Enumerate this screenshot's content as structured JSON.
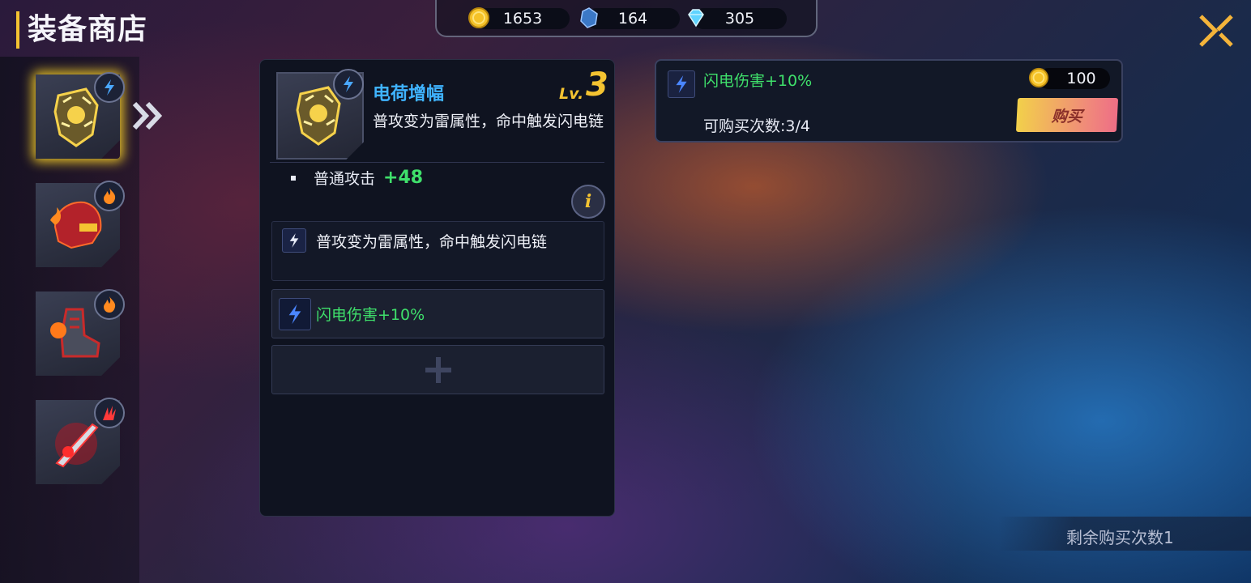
{
  "header": {
    "title": "装备商店"
  },
  "currencies": [
    {
      "icon": "gold-coin-icon",
      "value": "1653"
    },
    {
      "icon": "blue-crystal-icon",
      "value": "164"
    },
    {
      "icon": "diamond-icon",
      "value": "305"
    }
  ],
  "equipment_slots": [
    {
      "icon": "lightning-gauntlet-icon",
      "element_badge": "lightning-icon",
      "selected": true
    },
    {
      "icon": "fire-helmet-icon",
      "element_badge": "fire-icon",
      "selected": false
    },
    {
      "icon": "fire-boots-icon",
      "element_badge": "fire-icon",
      "selected": false
    },
    {
      "icon": "blood-sword-icon",
      "element_badge": "claw-icon",
      "selected": false
    }
  ],
  "detail": {
    "name": "电荷增幅",
    "level_prefix": "Lv.",
    "level": "3",
    "description": "普攻变为雷属性，命中触发闪电链",
    "stat_label": "普通攻击",
    "stat_value": "+48",
    "info_label": "i",
    "passive_text": "普攻变为雷属性，命中触发闪电链",
    "modifier_text": "闪电伤害+10%"
  },
  "offer": {
    "name": "闪电伤害+10%",
    "price": "100",
    "buy_label": "购买",
    "purchase_limit": "可购买次数:3/4"
  },
  "footer": {
    "remaining": "剩余购买次数1"
  },
  "colors": {
    "accent_gold": "#f4c331",
    "title_blue": "#3fb3ff",
    "bonus_green": "#3fe06b"
  }
}
